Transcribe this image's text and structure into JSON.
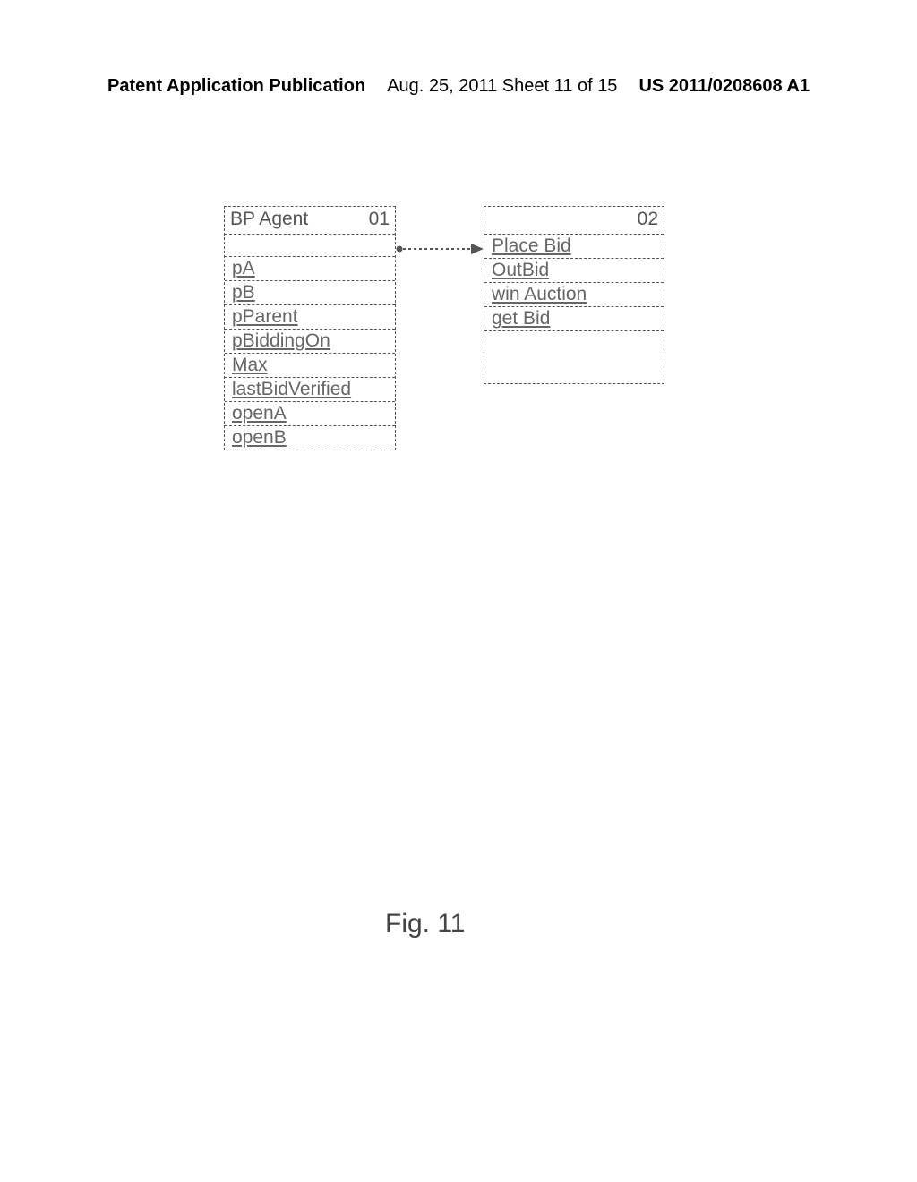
{
  "header": {
    "left": "Patent Application Publication",
    "center": "Aug. 25, 2011  Sheet 11 of 15",
    "right": "US 2011/0208608 A1"
  },
  "left_box": {
    "title": "BP Agent",
    "number": "01",
    "rows": [
      "pA",
      "pB",
      "pParent",
      "pBiddingOn",
      "Max",
      "lastBidVerified",
      "openA",
      "openB"
    ]
  },
  "right_box": {
    "title": "",
    "number": "02",
    "rows": [
      "Place Bid",
      "OutBid",
      "win Auction",
      "get Bid"
    ]
  },
  "figure": "Fig. 11"
}
